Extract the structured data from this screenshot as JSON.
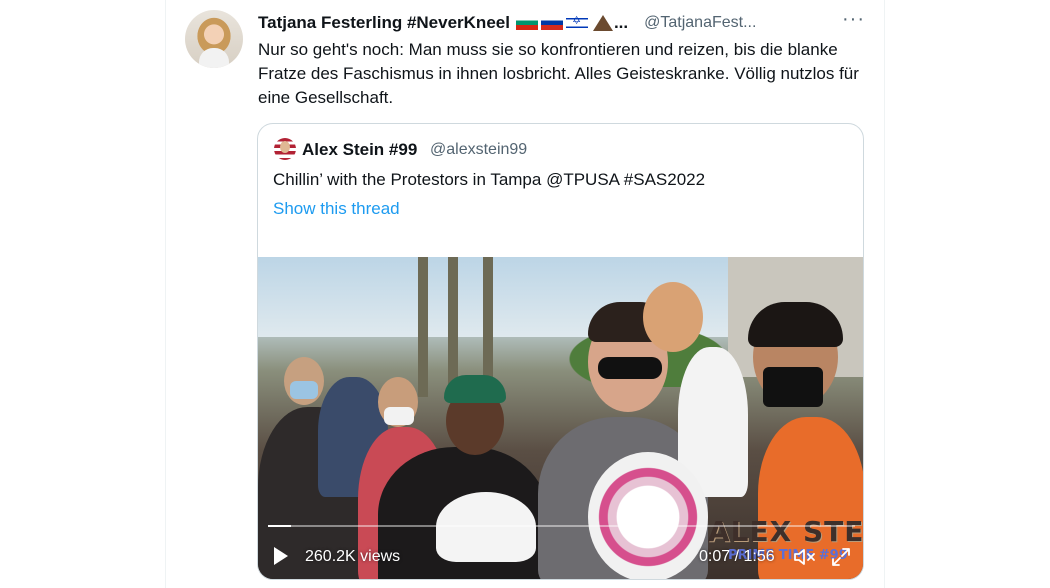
{
  "tweet": {
    "author_name": "Tatjana Festerling #NeverKneel",
    "name_truncation": "...",
    "author_handle": "@TatjanaFest...",
    "flag_icons": [
      "bulgaria-flag-icon",
      "russia-flag-icon",
      "israel-flag-icon",
      "volcano-icon"
    ],
    "text": "Nur so geht's noch: Man muss sie so konfrontieren und reizen, bis die blanke Fratze des Faschismus in ihnen losbricht. Alles Geisteskranke. Völlig nutzlos für eine Gesellschaft.",
    "more_icon": "more-horizontal-icon"
  },
  "quote": {
    "author_name": "Alex Stein #99",
    "author_handle": "@alexstein99",
    "text": "Chillin’ with the Protestors in Tampa @TPUSA #SAS2022",
    "show_thread_label": "Show this thread"
  },
  "video": {
    "views": "260.2K views",
    "time": "0:07 / 1:56",
    "progress": 0.04,
    "watermark_title": "ALEX STEIN",
    "watermark_subtitle": "PRIME TIME #99"
  },
  "colors": {
    "link": "#1d9bf0",
    "secondary_text": "#536471",
    "border": "#cfd9de"
  }
}
